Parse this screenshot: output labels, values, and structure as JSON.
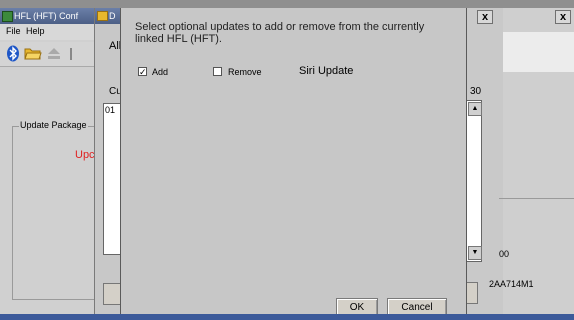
{
  "win1": {
    "title": "HFL (HFT) Conf",
    "menu_file": "File",
    "menu_help": "Help",
    "group_label": "Update Package",
    "red_text": "Upc"
  },
  "win2": {
    "title": "D",
    "label_all": "All",
    "label_cu": "Cu",
    "list_first": "01"
  },
  "winR": {
    "close": "x",
    "label_30": "30",
    "value_00": "00"
  },
  "winFar": {
    "close": "x",
    "serial": "2AA714M1"
  },
  "dialog": {
    "prompt": "Select optional updates to add or remove from the currently linked HFL (HFT).",
    "add_label": "Add",
    "add_checked": true,
    "remove_label": "Remove",
    "remove_checked": false,
    "update_name": "Siri Update",
    "ok_label": "OK",
    "cancel_label": "Cancel"
  }
}
